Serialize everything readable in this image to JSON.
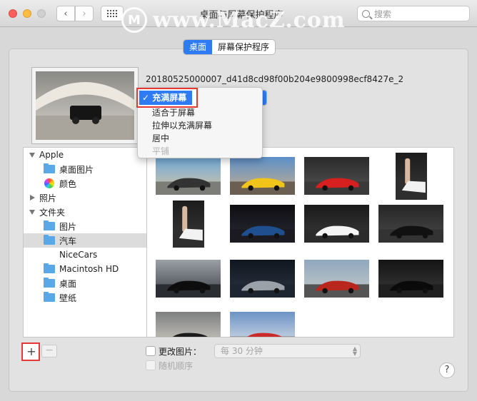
{
  "window": {
    "title": "桌面与屏幕保护程序"
  },
  "search": {
    "placeholder": "搜索"
  },
  "watermark": {
    "text": "www.MacZ.com"
  },
  "tabs": [
    {
      "label": "桌面",
      "active": true
    },
    {
      "label": "屏幕保护程序",
      "active": false
    }
  ],
  "current": {
    "filename": "20180525000007_d41d8cd98f00b204e9800998ecf8427e_2",
    "fit_selected": "充满屏幕"
  },
  "fit_menu": {
    "items": [
      {
        "label": "充满屏幕",
        "checked": true,
        "disabled": false
      },
      {
        "label": "适合于屏幕",
        "checked": false,
        "disabled": false
      },
      {
        "label": "拉伸以充满屏幕",
        "checked": false,
        "disabled": false
      },
      {
        "label": "居中",
        "checked": false,
        "disabled": false
      },
      {
        "label": "平铺",
        "checked": false,
        "disabled": true
      }
    ],
    "check_mark": "✓"
  },
  "sidebar": {
    "items": [
      {
        "label": "Apple",
        "kind": "group",
        "expanded": true
      },
      {
        "label": "桌面图片",
        "kind": "folder"
      },
      {
        "label": "颜色",
        "kind": "colors"
      },
      {
        "label": "照片",
        "kind": "group",
        "expanded": false
      },
      {
        "label": "文件夹",
        "kind": "group",
        "expanded": true
      },
      {
        "label": "图片",
        "kind": "folder"
      },
      {
        "label": "汽车",
        "kind": "folder",
        "selected": true
      },
      {
        "label": "NiceCars",
        "kind": "blank"
      },
      {
        "label": "Macintosh HD",
        "kind": "folder"
      },
      {
        "label": "桌面",
        "kind": "folder"
      },
      {
        "label": "壁纸",
        "kind": "folder"
      }
    ]
  },
  "thumbnails": [
    {
      "name": "coastal-sedan",
      "scene": "coast"
    },
    {
      "name": "yellow-sportscar",
      "scene": "road-yellow"
    },
    {
      "name": "red-ferrari",
      "scene": "studio-red"
    },
    {
      "name": "model-white-lambo",
      "scene": "portrait"
    },
    {
      "name": "model-white-lambo-2",
      "scene": "portrait"
    },
    {
      "name": "blue-bugatti",
      "scene": "studio-blue"
    },
    {
      "name": "white-lamborghini",
      "scene": "studio-white"
    },
    {
      "name": "black-lamborghini",
      "scene": "logo-dark"
    },
    {
      "name": "black-car-garage",
      "scene": "garage"
    },
    {
      "name": "silver-mercedes",
      "scene": "dark-silver"
    },
    {
      "name": "red-car-road",
      "scene": "road-red"
    },
    {
      "name": "black-car-dark",
      "scene": "dark-black"
    },
    {
      "name": "tunnel-suv",
      "scene": "tunnel"
    },
    {
      "name": "red-racecar",
      "scene": "sky-red"
    }
  ],
  "bottom": {
    "add_label": "+",
    "remove_label": "−",
    "change_picture_label": "更改图片：",
    "interval_value": "每 30 分钟",
    "random_label": "随机顺序",
    "help_label": "?"
  },
  "colors": {
    "accent": "#2f7bf5",
    "highlight_box": "#e53935"
  }
}
